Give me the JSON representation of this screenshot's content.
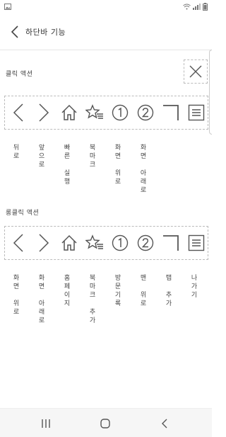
{
  "app": {
    "title": "하단바 기능"
  },
  "sections": {
    "click": {
      "label": "클릭 액션"
    },
    "longclick": {
      "label": "롱클릭 액션"
    }
  },
  "icons": [
    "back-icon",
    "forward-icon",
    "home-icon",
    "bookmark-star-icon",
    "number-1-icon",
    "number-2-icon",
    "corner-icon",
    "menu-lines-icon"
  ],
  "click_actions": [
    {
      "label": "뒤\n로"
    },
    {
      "label": "앞\n으\n로"
    },
    {
      "label": "빠\n른\n\n실\n행"
    },
    {
      "label": "북\n마\n크"
    },
    {
      "label": "화\n면\n\n위\n로"
    },
    {
      "label": "화\n면\n\n아\n래\n로"
    }
  ],
  "longclick_actions": [
    {
      "label": "화\n면\n\n위\n로"
    },
    {
      "label": "화\n면\n\n아\n래\n로"
    },
    {
      "label": "홈\n페\n이\n지"
    },
    {
      "label": "북\n마\n크\n\n추\n가"
    },
    {
      "label": "방\n문\n기\n록"
    },
    {
      "label": "맨\n\n위\n로"
    },
    {
      "label": "탭\n\n추\n가"
    },
    {
      "label": "나\n가\n기"
    }
  ],
  "colors": {
    "icon_stroke": "#555555",
    "dashed_border": "#bbbbbb",
    "background": "#ffffff"
  }
}
